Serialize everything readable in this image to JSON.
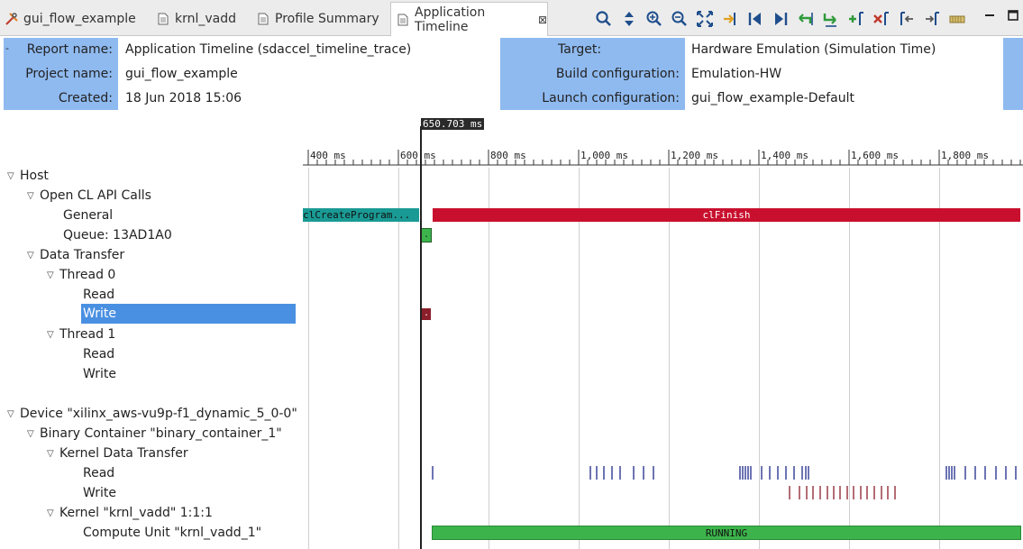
{
  "tabs": [
    {
      "label": "gui_flow_example",
      "icon": "project-tools-icon"
    },
    {
      "label": "krnl_vadd",
      "icon": "document-icon"
    },
    {
      "label": "Profile Summary",
      "icon": "document-icon"
    },
    {
      "label": "Application Timeline",
      "icon": "document-icon",
      "close": "⊠",
      "active": true
    }
  ],
  "toolbar": [
    "search-icon",
    "expand-collapse-icon",
    "zoom-in-icon",
    "zoom-out-icon",
    "zoom-fit-icon",
    "goto-marker-icon",
    "previous-event-icon",
    "next-event-icon",
    "previous-transaction-icon",
    "next-transaction-icon",
    "add-marker-icon",
    "remove-marker-icon",
    "previous-marker-icon",
    "next-marker-icon",
    "legend-icon"
  ],
  "report": {
    "left": [
      {
        "label": "Report name:",
        "value": "Application Timeline (sdaccel_timeline_trace)"
      },
      {
        "label": "Project name:",
        "value": "gui_flow_example"
      },
      {
        "label": "Created:",
        "value": "18 Jun 2018 15:06"
      }
    ],
    "right": [
      {
        "label": "Target:",
        "value": "Hardware Emulation (Simulation Time)"
      },
      {
        "label": "Build configuration:",
        "value": "Emulation-HW"
      },
      {
        "label": "Launch configuration:",
        "value": "gui_flow_example-Default"
      }
    ],
    "collapse_glyph": "-"
  },
  "cursor": {
    "label": "650.703 ms"
  },
  "ruler": {
    "ticks": [
      "400 ms",
      "600 ms",
      "800 ms",
      "1,000 ms",
      "1,200 ms",
      "1,400 ms",
      "1,600 ms",
      "1,800 ms"
    ]
  },
  "tree": [
    {
      "label": "Host",
      "expanded": true
    },
    {
      "label": "Open CL API Calls",
      "expanded": true
    },
    {
      "label": "General"
    },
    {
      "label": "Queue: 13AD1A0"
    },
    {
      "label": "Data Transfer",
      "expanded": true
    },
    {
      "label": "Thread 0",
      "expanded": true
    },
    {
      "label": "Read"
    },
    {
      "label": "Write",
      "selected": true
    },
    {
      "label": "Thread 1",
      "expanded": true
    },
    {
      "label": "Read"
    },
    {
      "label": "Write"
    },
    {
      "label": "Device \"xilinx_aws-vu9p-f1_dynamic_5_0-0\"",
      "expanded": true
    },
    {
      "label": "Binary Container \"binary_container_1\"",
      "expanded": true
    },
    {
      "label": "Kernel Data Transfer",
      "expanded": true
    },
    {
      "label": "Read"
    },
    {
      "label": "Write"
    },
    {
      "label": "Kernel \"krnl_vadd\" 1:1:1",
      "expanded": true
    },
    {
      "label": "Compute Unit \"krnl_vadd_1\""
    }
  ],
  "events": {
    "cl_create_program": "clCreateProgram...",
    "cl_finish": "clFinish",
    "queue_marker": ".",
    "write_marker": ".",
    "running": "RUNNING"
  },
  "colors": {
    "header_blue": "#8fbaf0",
    "selection_blue": "#4a90e2",
    "teal": "#1a9a94",
    "red": "#c8102e",
    "green": "#3cb44b",
    "maroon": "#8b1e2b",
    "kernel_read_tick": "#1c2a8a",
    "kernel_write_tick": "#8b1e2b"
  }
}
